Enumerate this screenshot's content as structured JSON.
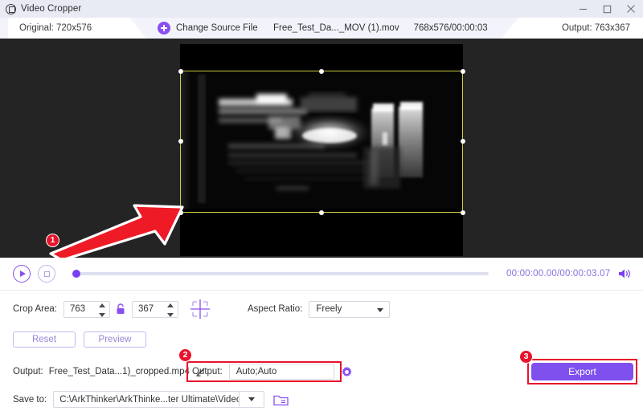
{
  "window": {
    "title": "Video Cropper",
    "app_icon": "crop-icon",
    "minimize_label": "—",
    "maximize_label": "□",
    "close_label": "✕"
  },
  "topbar": {
    "original_label": "Original: 720x576",
    "change_source_label": "Change Source File",
    "plus_icon": "plus-circle-icon",
    "file_name": "Free_Test_Da..._MOV (1).mov",
    "file_meta": "768x576/00:00:03",
    "output_label": "Output: 763x367"
  },
  "stage": {
    "crop_border_color": "#cfcf3f",
    "handle_color": "#ffffff",
    "background": "#242424"
  },
  "annotations": [
    {
      "id": "1",
      "target": "crop-handle-bottom-left"
    },
    {
      "id": "2",
      "target": "output-format-field"
    },
    {
      "id": "3",
      "target": "export-button"
    }
  ],
  "playback": {
    "play_icon": "play-icon",
    "stop_icon": "stop-icon",
    "seek_position_pct": 0,
    "timecode": "00:00:00.00/00:00:03.07",
    "volume_icon": "volume-icon"
  },
  "crop_controls": {
    "crop_area_label": "Crop Area:",
    "width_value": "763",
    "height_value": "367",
    "lock_icon": "lock-icon",
    "grid_icon": "crop-grid-icon",
    "aspect_ratio_label": "Aspect Ratio:",
    "aspect_ratio_value": "Freely"
  },
  "buttons": {
    "reset_label": "Reset",
    "preview_label": "Preview",
    "export_label": "Export",
    "export_color": "#8050ee"
  },
  "output": {
    "output_label": "Output:",
    "output_file_name": "Free_Test_Data...1)_cropped.mp4",
    "pencil_icon": "pencil-icon",
    "format_label": "Output:",
    "format_value": "Auto;Auto",
    "gear_icon": "gear-icon",
    "save_to_label": "Save to:",
    "save_to_path": "C:\\ArkThinker\\ArkThinke...ter Ultimate\\Video Crop",
    "folder_icon": "folder-icon",
    "dropdown_icon": "chevron-down-icon"
  }
}
